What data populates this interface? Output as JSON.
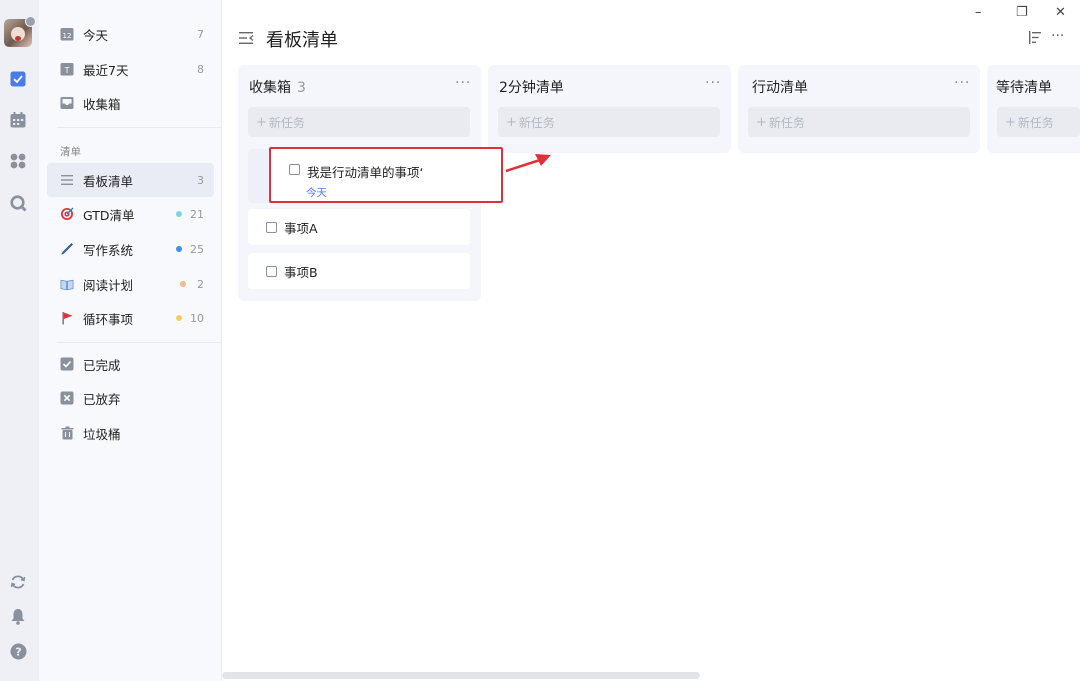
{
  "window": {
    "minimize": "–",
    "restore": "❐",
    "close": "✕"
  },
  "sidebar": {
    "smart_lists": [
      {
        "label": "今天",
        "count": "7",
        "icon": "calendar-12-icon"
      },
      {
        "label": "最近7天",
        "count": "8",
        "icon": "calendar-week-icon"
      },
      {
        "label": "收集箱",
        "count": "",
        "icon": "inbox-icon"
      }
    ],
    "section_label": "清单",
    "lists": [
      {
        "label": "看板清单",
        "count": "3",
        "icon": "list-lines-icon",
        "dot": "",
        "active": true
      },
      {
        "label": "GTD清单",
        "count": "21",
        "icon": "target-icon",
        "dot": "#7ad6e6"
      },
      {
        "label": "写作系统",
        "count": "25",
        "icon": "pen-icon",
        "dot": "#3d8ef0"
      },
      {
        "label": "阅读计划",
        "count": "2",
        "icon": "book-icon",
        "dot": "#f5b98a"
      },
      {
        "label": "循环事项",
        "count": "10",
        "icon": "flag-icon",
        "dot": "#f5cf5a"
      }
    ],
    "bottom_lists": [
      {
        "label": "已完成",
        "icon": "check-box-icon"
      },
      {
        "label": "已放弃",
        "icon": "x-box-icon"
      },
      {
        "label": "垃圾桶",
        "icon": "trash-icon"
      }
    ]
  },
  "header": {
    "title": "看板清单",
    "more": "···"
  },
  "columns": [
    {
      "title": "收集箱",
      "count": "3",
      "add_placeholder": "新任务",
      "more": "···"
    },
    {
      "title": "2分钟清单",
      "count": "",
      "add_placeholder": "新任务",
      "more": "···"
    },
    {
      "title": "行动清单",
      "count": "",
      "add_placeholder": "新任务",
      "more": "···"
    },
    {
      "title": "等待清单",
      "count": "",
      "add_placeholder": "新任务",
      "more": ""
    }
  ],
  "tasks": [
    {
      "label": "事项A"
    },
    {
      "label": "事项B"
    }
  ],
  "dragging_task": {
    "label": "我是行动清单的事项‘",
    "date": "今天"
  },
  "colors": {
    "accent": "#4a7be8",
    "highlight": "#e0313b",
    "rail_bg": "#eef0f6",
    "sidebar_bg": "#f8f9fc"
  }
}
